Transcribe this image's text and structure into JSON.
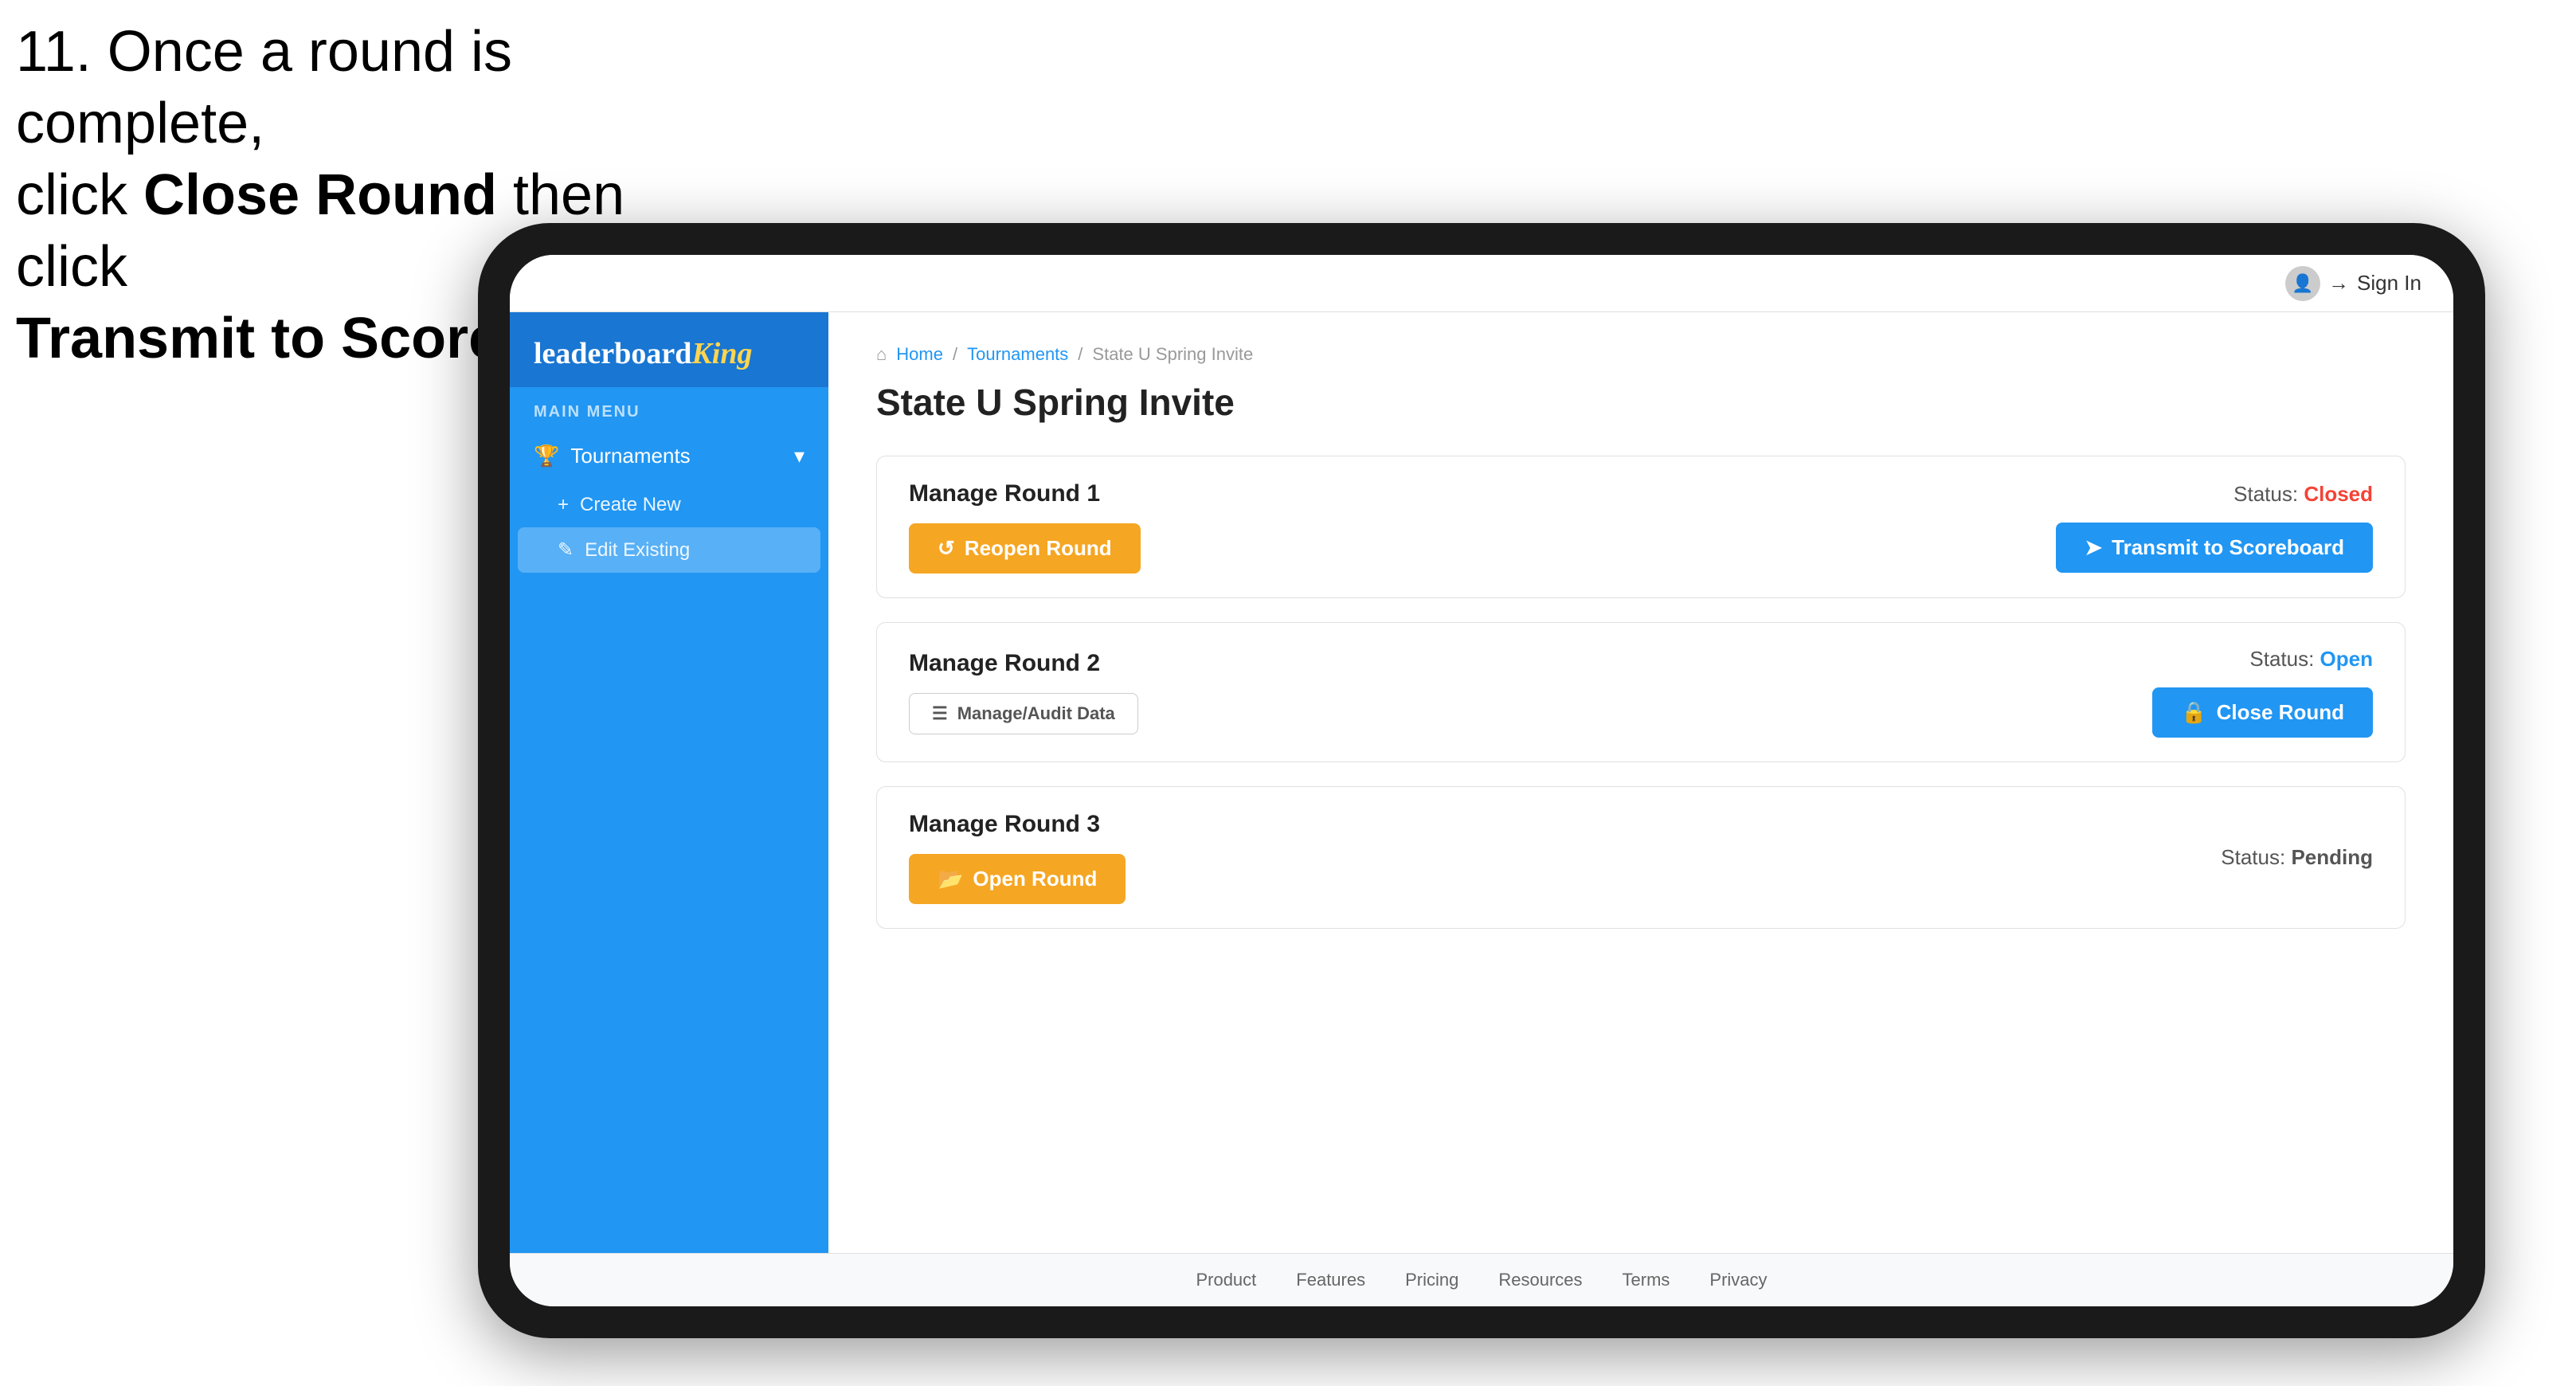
{
  "instruction": {
    "line1": "11. Once a round is complete,",
    "line2": "click ",
    "bold1": "Close Round",
    "line3": " then click",
    "line4": "",
    "bold2": "Transmit to Scoreboard."
  },
  "header": {
    "sign_in": "Sign In"
  },
  "sidebar": {
    "logo": "leaderboard",
    "logo_brand": "King",
    "main_menu_label": "MAIN MENU",
    "items": [
      {
        "label": "Tournaments",
        "icon": "trophy"
      },
      {
        "label": "Create New",
        "icon": "plus",
        "sub": true
      },
      {
        "label": "Edit Existing",
        "icon": "edit",
        "sub": true,
        "active": true
      }
    ]
  },
  "breadcrumb": {
    "home": "Home",
    "sep1": "/",
    "tournaments": "Tournaments",
    "sep2": "/",
    "current": "State U Spring Invite"
  },
  "page": {
    "title": "State U Spring Invite"
  },
  "rounds": [
    {
      "id": "round1",
      "title": "Manage Round 1",
      "status_label": "Status:",
      "status_value": "Closed",
      "status_class": "status-closed",
      "button1_label": "Reopen Round",
      "button1_type": "gold",
      "button2_label": "Transmit to Scoreboard",
      "button2_type": "blue"
    },
    {
      "id": "round2",
      "title": "Manage Round 2",
      "status_label": "Status:",
      "status_value": "Open",
      "status_class": "status-open",
      "button1_label": "Manage/Audit Data",
      "button1_type": "outline",
      "button2_label": "Close Round",
      "button2_type": "blue"
    },
    {
      "id": "round3",
      "title": "Manage Round 3",
      "status_label": "Status:",
      "status_value": "Pending",
      "status_class": "status-pending",
      "button1_label": "Open Round",
      "button1_type": "gold",
      "button2_label": null,
      "button2_type": null
    }
  ],
  "footer": {
    "links": [
      "Product",
      "Features",
      "Pricing",
      "Resources",
      "Terms",
      "Privacy"
    ]
  }
}
